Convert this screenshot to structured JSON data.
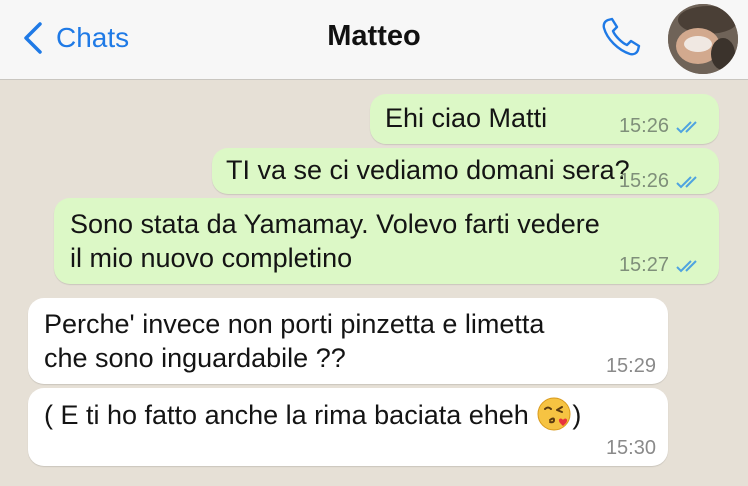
{
  "header": {
    "back_label": "Chats",
    "title": "Matteo"
  },
  "icons": {
    "back": "chevron-left-icon",
    "call": "phone-icon",
    "read": "double-check-icon",
    "emoji": "kissing-face-emoji"
  },
  "colors": {
    "accent": "#1f7ae6",
    "outgoing_bubble": "#dcf8c6",
    "incoming_bubble": "#ffffff",
    "background": "#e6e0d6",
    "read_ticks": "#4fa3e0"
  },
  "messages": [
    {
      "direction": "outgoing",
      "lines": [
        "Ehi ciao Matti"
      ],
      "time": "15:26",
      "status": "read"
    },
    {
      "direction": "outgoing",
      "lines": [
        "TI va se ci vediamo domani sera?"
      ],
      "time": "15:26",
      "status": "read"
    },
    {
      "direction": "outgoing",
      "lines": [
        "Sono stata da Yamamay. Volevo farti vedere",
        "il mio nuovo completino"
      ],
      "time": "15:27",
      "status": "read"
    },
    {
      "direction": "incoming",
      "lines": [
        "Perche' invece non porti pinzetta e limetta",
        "che sono inguardabile ??"
      ],
      "time": "15:29"
    },
    {
      "direction": "incoming",
      "lines": [
        "( E ti ho fatto anche la rima baciata eheh",
        ")"
      ],
      "time": "15:30"
    }
  ]
}
